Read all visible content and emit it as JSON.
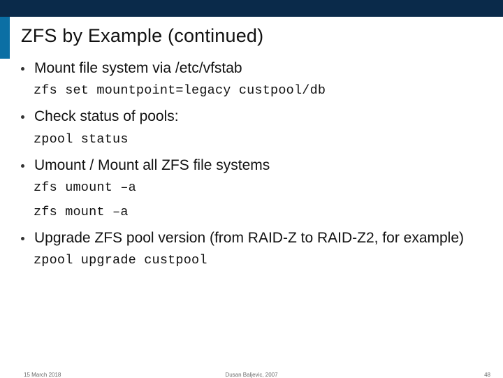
{
  "title": "ZFS by Example (continued)",
  "items": [
    {
      "heading": "Mount file system via /etc/vfstab",
      "code": [
        "zfs set mountpoint=legacy custpool/db"
      ]
    },
    {
      "heading": "Check status of pools:",
      "code": [
        "zpool status"
      ]
    },
    {
      "heading": "Umount / Mount all ZFS file systems",
      "code": [
        "zfs umount –a",
        "zfs mount –a"
      ]
    },
    {
      "heading": "Upgrade ZFS pool version (from RAID-Z to RAID-Z2, for example)",
      "code": [
        "zpool upgrade custpool"
      ]
    }
  ],
  "footer": {
    "left": "15 March 2018",
    "center": "Dusan Baljevic, 2007",
    "right": "48"
  }
}
